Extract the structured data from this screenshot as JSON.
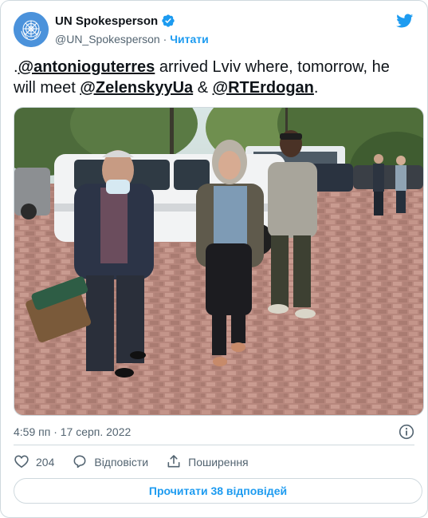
{
  "account": {
    "display_name": "UN Spokesperson",
    "handle": "@UN_Spokesperson",
    "separator": " · ",
    "follow_label": "Читати"
  },
  "tweet": {
    "prefix": ".",
    "mention_1": "@antonioguterres",
    "text_1": " arrived Lviv where, tomorrow, he will meet ",
    "mention_2": "@ZelenskyyUa",
    "text_2": " & ",
    "mention_3": "@RTErdogan",
    "text_3": "."
  },
  "timestamp": "4:59 пп · 17 серп. 2022",
  "actions": {
    "like_count": "204",
    "reply_label": "Відповісти",
    "share_label": "Поширення"
  },
  "read_replies_label": "Прочитати 38 відповідей",
  "icons": {
    "avatar": "un-emblem-icon",
    "verified": "verified-badge-icon",
    "brand": "twitter-bird-icon",
    "info": "info-icon",
    "like": "heart-icon",
    "reply": "speech-bubble-icon",
    "share": "share-upload-icon"
  },
  "colors": {
    "accent": "#1d9bf0",
    "text": "#0f1419",
    "secondary": "#536471",
    "border": "#cfd9de",
    "un_blue": "#4b92db"
  }
}
